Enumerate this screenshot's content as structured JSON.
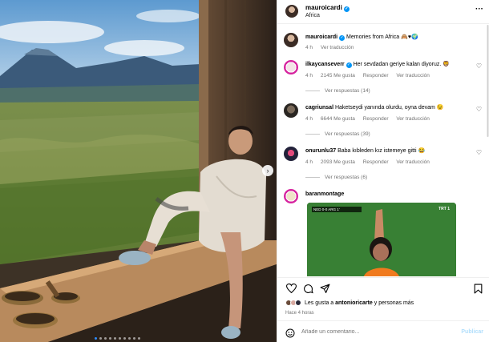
{
  "post": {
    "username": "mauroicardi",
    "location": "Africa",
    "more_icon": "more-horizontal-icon"
  },
  "caption": {
    "username": "mauroicardi",
    "text": "Memories from Africa 🙈♥🌍",
    "time": "4 h",
    "translate": "Ver traducción"
  },
  "comments": [
    {
      "username": "ilkaycanseverr",
      "text": "Her sevdadan geriye kalan diyoruz. 🦁",
      "time": "4 h",
      "likes": "2145 Me gusta",
      "reply": "Responder",
      "translate": "Ver traducción",
      "replies": "Ver respuestas (14)"
    },
    {
      "username": "cagriunsal",
      "text": "Haketseydi yanında olurdu, oyna devam 😉",
      "time": "4 h",
      "likes": "6644 Me gusta",
      "reply": "Responder",
      "translate": "Ver traducción",
      "replies": "Ver respuestas (39)"
    },
    {
      "username": "onurunlu37",
      "text": "Baba kıbleden kız istemeye gitti 😂",
      "time": "4 h",
      "likes": "2093 Me gusta",
      "reply": "Responder",
      "translate": "Ver traducción",
      "replies": "Ver respuestas (6)"
    }
  ],
  "last_comment": {
    "username": "baranmontage",
    "clip_score": "NED 0-0 ARG 1'",
    "clip_channel": "TRT 1"
  },
  "actions": [
    "heart-icon",
    "comment-icon",
    "share-icon",
    "bookmark-icon"
  ],
  "likes": {
    "prefix": "Les gusta a ",
    "user": "antonioricarte",
    "suffix": " y personas más"
  },
  "time_ago": "Hace 4 horas",
  "add_comment": {
    "placeholder": "Añade un comentario...",
    "publish": "Publicar"
  },
  "carousel": {
    "total": 10,
    "active_index": 0
  },
  "colors": {
    "accent": "#0095f6",
    "muted": "#737373",
    "publish_disabled": "#b2dffc"
  }
}
